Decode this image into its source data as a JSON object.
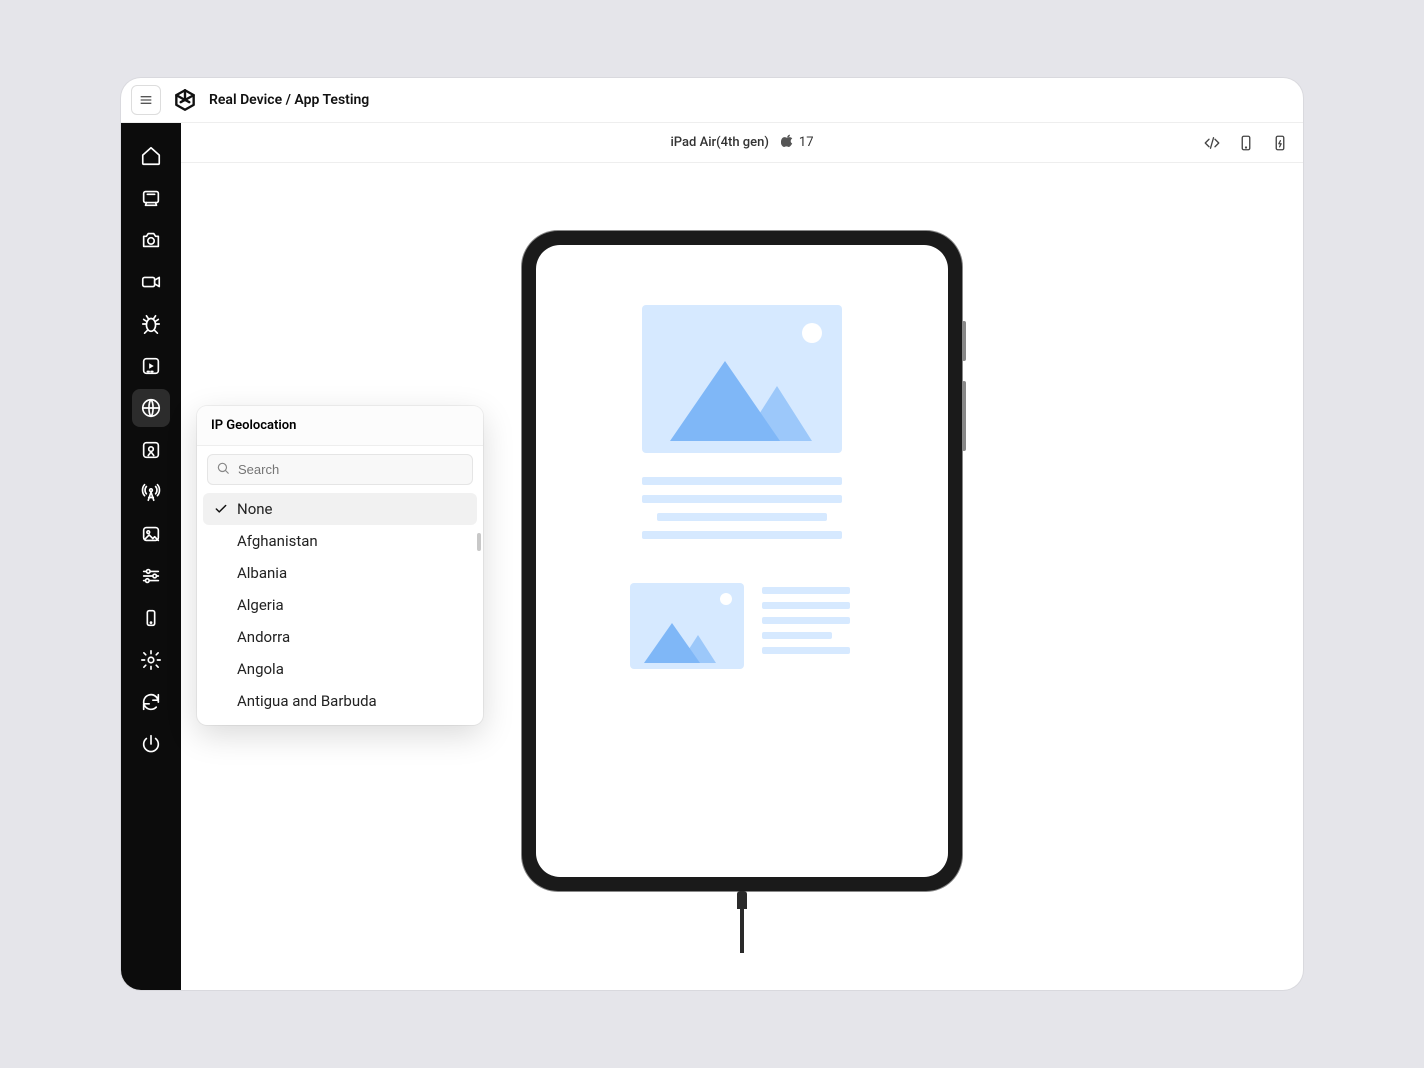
{
  "breadcrumb": "Real Device / App Testing",
  "device": {
    "name": "iPad Air(4th gen)",
    "os_version": "17"
  },
  "sidebar": {
    "items": [
      {
        "name": "home-icon"
      },
      {
        "name": "app-icon"
      },
      {
        "name": "camera-icon"
      },
      {
        "name": "video-icon"
      },
      {
        "name": "bug-icon"
      },
      {
        "name": "devtools-icon"
      },
      {
        "name": "globe-icon"
      },
      {
        "name": "location-pin-icon"
      },
      {
        "name": "network-tower-icon"
      },
      {
        "name": "image-icon"
      },
      {
        "name": "sliders-icon"
      },
      {
        "name": "device-rotate-icon"
      },
      {
        "name": "settings-icon"
      },
      {
        "name": "refresh-icon"
      },
      {
        "name": "power-icon"
      }
    ]
  },
  "infobar_actions": [
    {
      "name": "code-icon"
    },
    {
      "name": "device-outline-icon"
    },
    {
      "name": "device-charge-icon"
    }
  ],
  "geoPopup": {
    "title": "IP Geolocation",
    "searchPlaceholder": "Search",
    "items": [
      {
        "label": "None",
        "selected": true
      },
      {
        "label": "Afghanistan",
        "selected": false
      },
      {
        "label": "Albania",
        "selected": false
      },
      {
        "label": "Algeria",
        "selected": false
      },
      {
        "label": "Andorra",
        "selected": false
      },
      {
        "label": "Angola",
        "selected": false
      },
      {
        "label": "Antigua and Barbuda",
        "selected": false
      }
    ]
  }
}
